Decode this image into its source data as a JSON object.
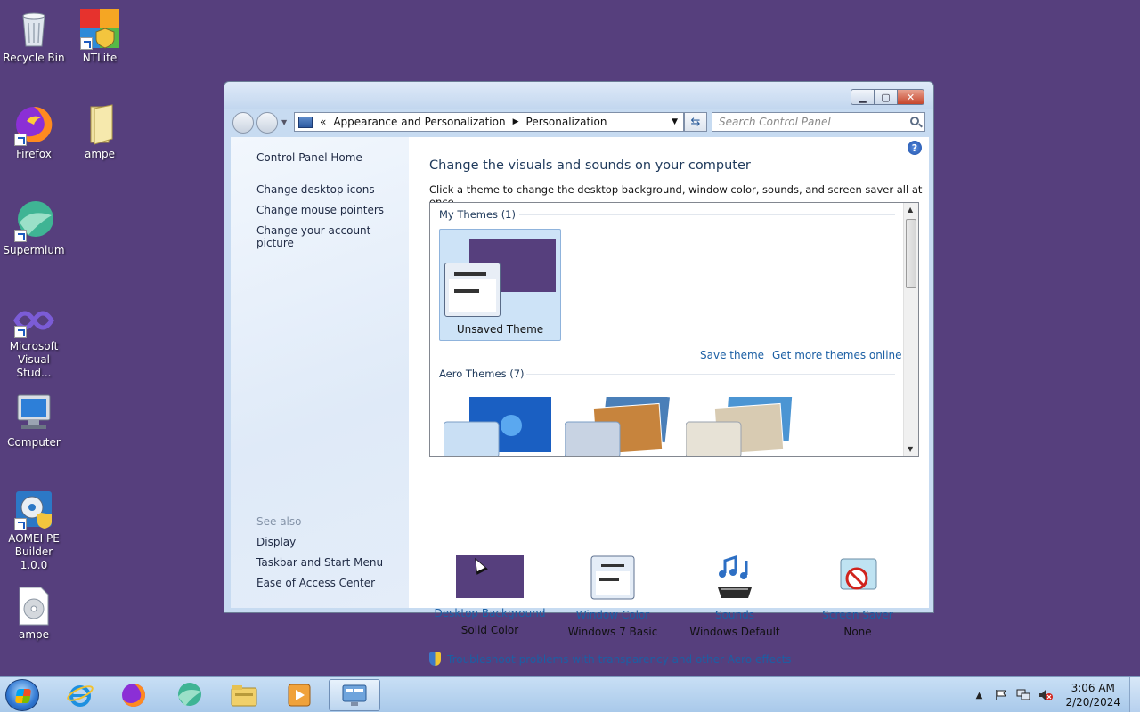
{
  "desktop": {
    "icons": [
      {
        "label": "Recycle Bin"
      },
      {
        "label": "NTLite"
      },
      {
        "label": "Firefox"
      },
      {
        "label": "ampe"
      },
      {
        "label": "Supermium"
      },
      {
        "label": "Microsoft Visual Stud..."
      },
      {
        "label": "Computer"
      },
      {
        "label": "AOMEI PE Builder 1.0.0"
      },
      {
        "label": "ampe"
      }
    ]
  },
  "window": {
    "caption": {
      "min": "▁",
      "max": "▢",
      "close": "✕"
    },
    "address": {
      "overflow": "«",
      "segments": [
        "Appearance and Personalization",
        "Personalization"
      ],
      "separator": "▶"
    },
    "search": {
      "placeholder": "Search Control Panel"
    },
    "help": "?",
    "left_pane": {
      "home": "Control Panel Home",
      "tasks": [
        "Change desktop icons",
        "Change mouse pointers",
        "Change your account picture"
      ],
      "see_also_header": "See also",
      "see_also": [
        "Display",
        "Taskbar and Start Menu",
        "Ease of Access Center"
      ]
    },
    "content": {
      "title": "Change the visuals and sounds on your computer",
      "description": "Click a theme to change the desktop background, window color, sounds, and screen saver all at once.",
      "my_themes_header": "My Themes (1)",
      "unsaved_theme": "Unsaved Theme",
      "save_theme": "Save theme",
      "get_more": "Get more themes online",
      "aero_themes_header": "Aero Themes (7)",
      "options": [
        {
          "title": "Desktop Background",
          "value": "Solid Color"
        },
        {
          "title": "Window Color",
          "value": "Windows 7 Basic"
        },
        {
          "title": "Sounds",
          "value": "Windows Default"
        },
        {
          "title": "Screen Saver",
          "value": "None"
        }
      ],
      "troubleshoot": "Troubleshoot problems with transparency and other Aero effects"
    }
  },
  "taskbar": {
    "clock_time": "3:06 AM",
    "clock_date": "2/20/2024",
    "tray_arrow": "▲"
  },
  "colors": {
    "desktop": "#563f7d",
    "link": "#1b5fa4",
    "heading": "#1e395b"
  }
}
